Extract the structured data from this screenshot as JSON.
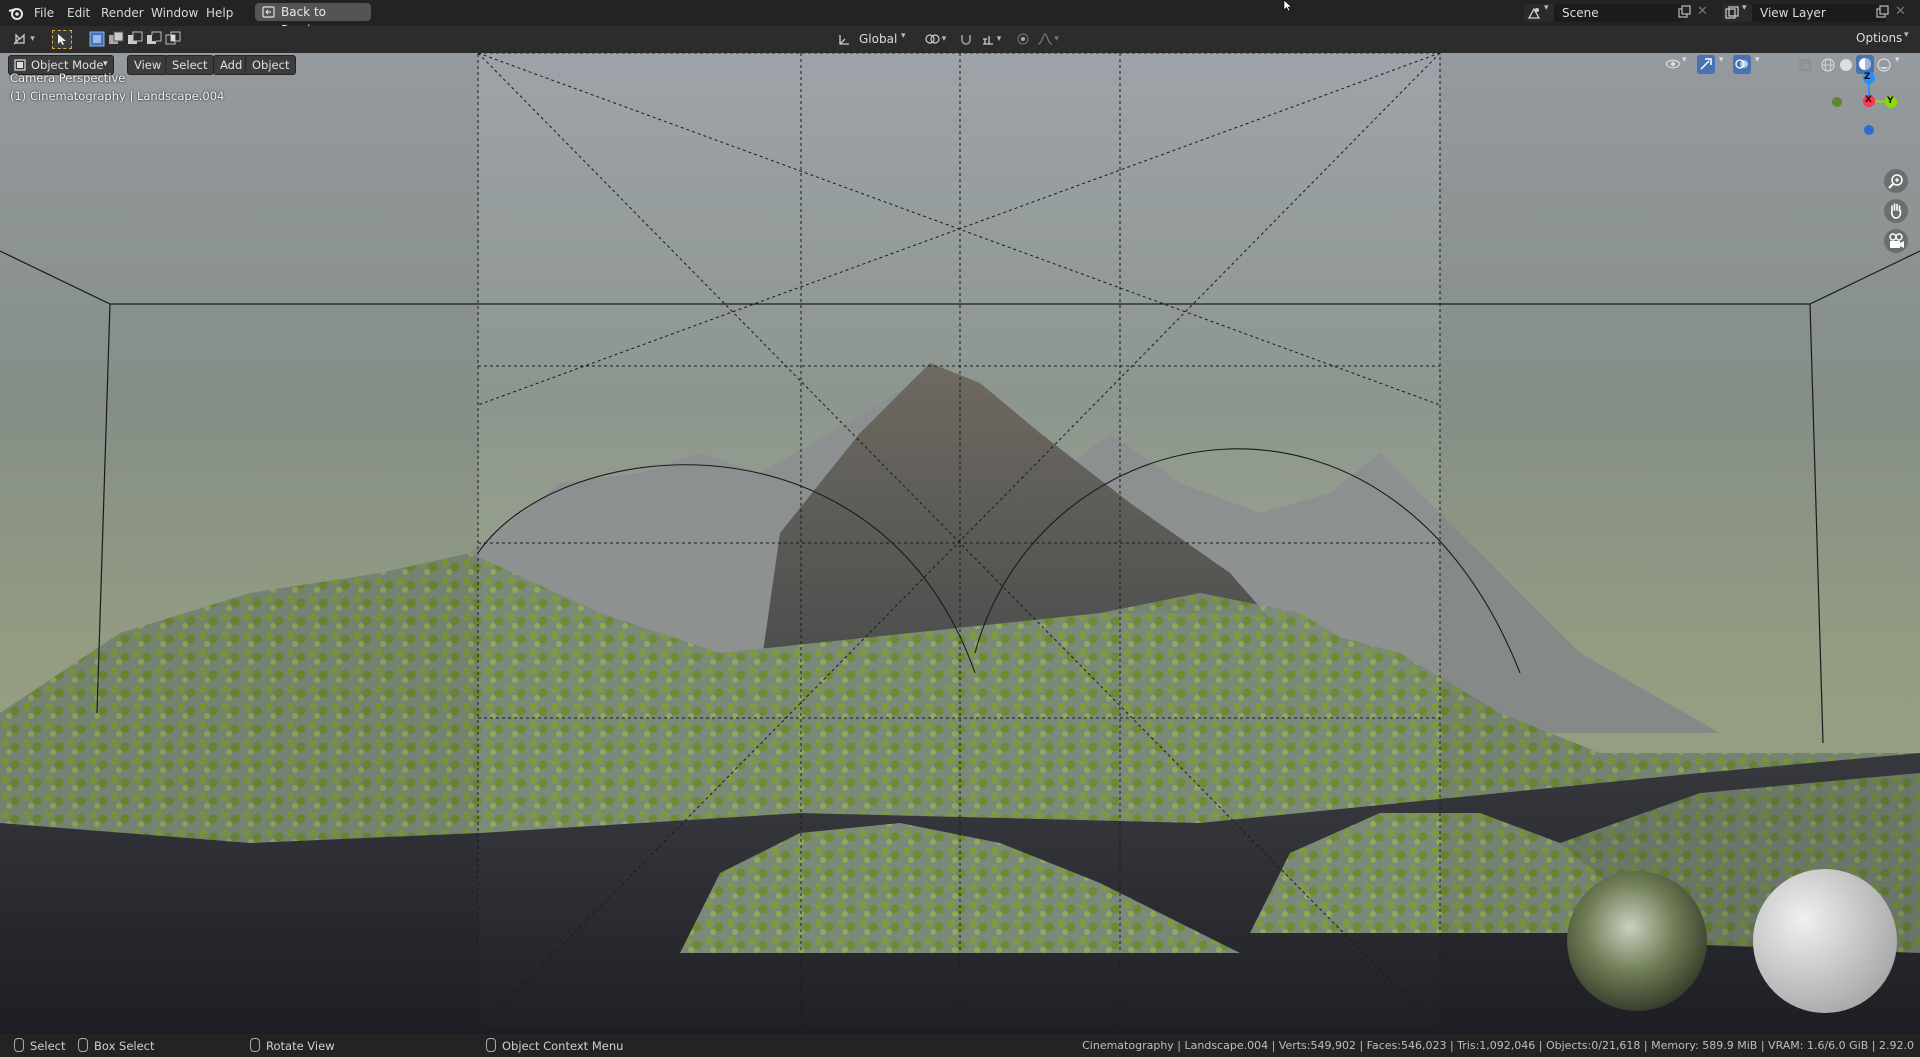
{
  "topbar": {
    "menus": [
      "File",
      "Edit",
      "Render",
      "Window",
      "Help"
    ],
    "back_button": "Back to Previous",
    "scene_value": "Scene",
    "view_layer_value": "View Layer"
  },
  "header": {
    "transform_orientation": "Global",
    "options_label": "Options"
  },
  "viewport_header": {
    "mode": "Object Mode",
    "menus": [
      "View",
      "Select",
      "Add",
      "Object"
    ]
  },
  "overlay": {
    "camera_line": "Camera Perspective",
    "object_line": "(1) Cinematography | Landscape.004"
  },
  "gizmo": {
    "z": "Z",
    "x": "X",
    "y": "Y"
  },
  "statusbar": {
    "select": "Select",
    "box_select": "Box Select",
    "rotate_view": "Rotate View",
    "context_menu": "Object Context Menu",
    "stats": "Cinematography | Landscape.004 | Verts:549,902 | Faces:546,023 | Tris:1,092,046 | Objects:0/21,618 | Memory: 589.9 MiB | VRAM: 1.6/6.0 GiB | 2.92.0"
  },
  "colors": {
    "accent_blue": "#4772b3",
    "x_axis": "#ff3352",
    "y_axis": "#8bdc00",
    "z_axis": "#2890ff"
  },
  "icons": [
    "blender-logo-icon",
    "editor-type-icon",
    "select-tool-icon",
    "select-mode-new-icon",
    "select-mode-extend-icon",
    "select-mode-subtract-icon",
    "select-mode-difference-icon",
    "select-mode-intersect-icon",
    "back-icon",
    "scene-icon",
    "new-scene-icon",
    "close-icon",
    "view-layer-icon",
    "transform-orientation-icon",
    "pivot-icon",
    "snap-icon",
    "proportional-icon",
    "visibility-icon",
    "gizmo-icon",
    "overlay-icon",
    "xray-icon",
    "shading-wireframe-icon",
    "shading-solid-icon",
    "shading-material-icon",
    "shading-rendered-icon",
    "zoom-icon",
    "pan-icon",
    "camera-view-icon",
    "mouse-icon"
  ]
}
